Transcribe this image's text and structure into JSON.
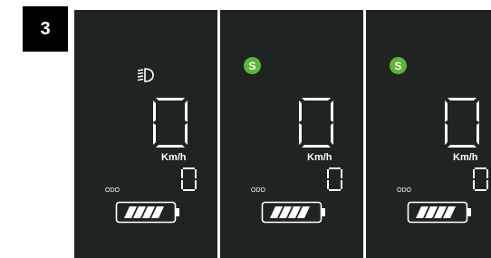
{
  "step": {
    "number": "3"
  },
  "panels": [
    {
      "id": "panel-1",
      "indicator": "headlight-icon",
      "speed": "0",
      "unit": "Km/h",
      "odometer_label": "ODO",
      "trip": "0",
      "battery_fill_fraction": 1.0
    },
    {
      "id": "panel-2",
      "indicator": "sport-mode-icon",
      "sport_label": "S",
      "speed": "0",
      "unit": "Km/h",
      "odometer_label": "ODO",
      "trip": "0",
      "battery_fill_fraction": 1.0
    },
    {
      "id": "panel-3",
      "indicator": "sport-mode-icon",
      "sport_label": "S",
      "speed": "0",
      "unit": "Km/h",
      "odometer_label": "ODO",
      "trip": "0",
      "battery_fill_fraction": 1.0
    }
  ],
  "colors": {
    "panel_background": "#1f2422",
    "sport_indicator": "#5fb43a",
    "display_foreground": "#ffffff"
  }
}
